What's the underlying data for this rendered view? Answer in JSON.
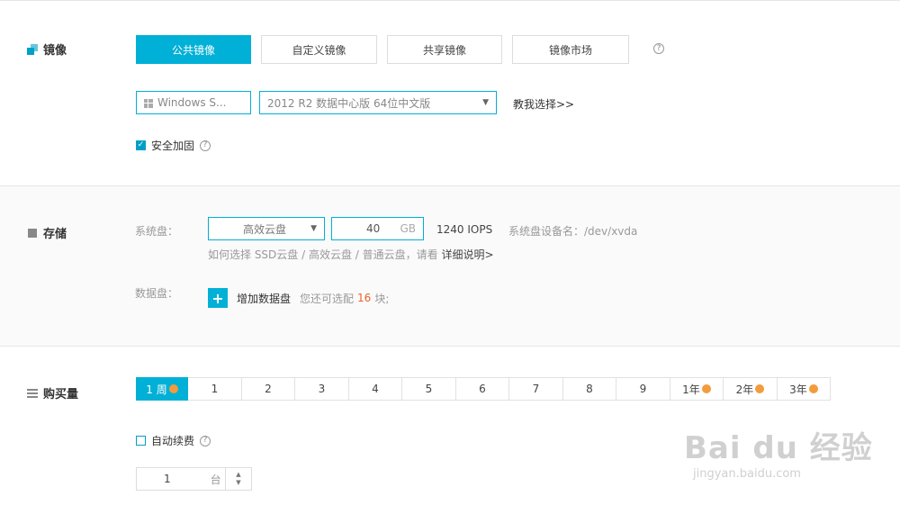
{
  "image_section": {
    "title": "镜像",
    "tabs": [
      "公共镜像",
      "自定义镜像",
      "共享镜像",
      "镜像市场"
    ],
    "active_tab": 0,
    "help": "?",
    "os_select": "Windows S...",
    "version_select": "2012 R2 数据中心版 64位中文版",
    "guide_link": "教我选择>>",
    "security_label": "安全加固",
    "security_checked": true
  },
  "storage_section": {
    "title": "存储",
    "system_disk_label": "系统盘：",
    "disk_type": "高效云盘",
    "disk_size": "40",
    "disk_unit": "GB",
    "iops": "1240 IOPS",
    "device_label": "系统盘设备名：/dev/xvda",
    "how_to_text": "如何选择 SSD云盘 / 高效云盘 / 普通云盘，请看",
    "how_to_link": "详细说明>",
    "data_disk_label": "数据盘：",
    "add_data_disk": "增加数据盘",
    "remaining_prefix": "您还可选配",
    "remaining_count": "16",
    "remaining_suffix": "块;"
  },
  "buy_section": {
    "title": "购买量",
    "durations": [
      "1 周",
      "1",
      "2",
      "3",
      "4",
      "5",
      "6",
      "7",
      "8",
      "9",
      "1年",
      "2年",
      "3年"
    ],
    "active_duration": 0,
    "auto_renew_label": "自动续费",
    "auto_renew_checked": false,
    "quantity": "1",
    "quantity_unit": "台"
  },
  "watermark": {
    "logo": "Bai du 经验",
    "url": "jingyan.baidu.com"
  },
  "colors": {
    "accent": "#00b0d6",
    "badge": "#f39b3d",
    "highlight": "#e8632b"
  }
}
